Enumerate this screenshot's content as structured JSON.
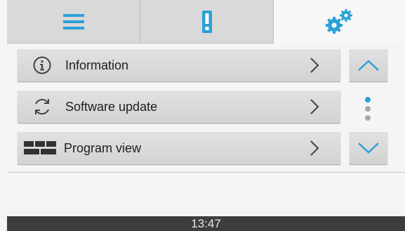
{
  "tabs": [
    {
      "icon": "menu-lines-icon",
      "active": false
    },
    {
      "icon": "device-alert-icon",
      "active": false
    },
    {
      "icon": "gears-icon",
      "active": true
    }
  ],
  "menu": {
    "items": [
      {
        "label": "Information",
        "icon": "info-circle-icon"
      },
      {
        "label": "Software update",
        "icon": "sync-icon"
      },
      {
        "label": "Program view",
        "icon": "grid-icon"
      }
    ]
  },
  "scroll": {
    "up_icon": "chevron-up-icon",
    "down_icon": "chevron-down-icon",
    "position": "top"
  },
  "status": {
    "time": "13:47"
  },
  "colors": {
    "accent": "#2aa1d8",
    "inactive_dot": "#a8a8a8",
    "status_bar": "#3d3d3d"
  }
}
